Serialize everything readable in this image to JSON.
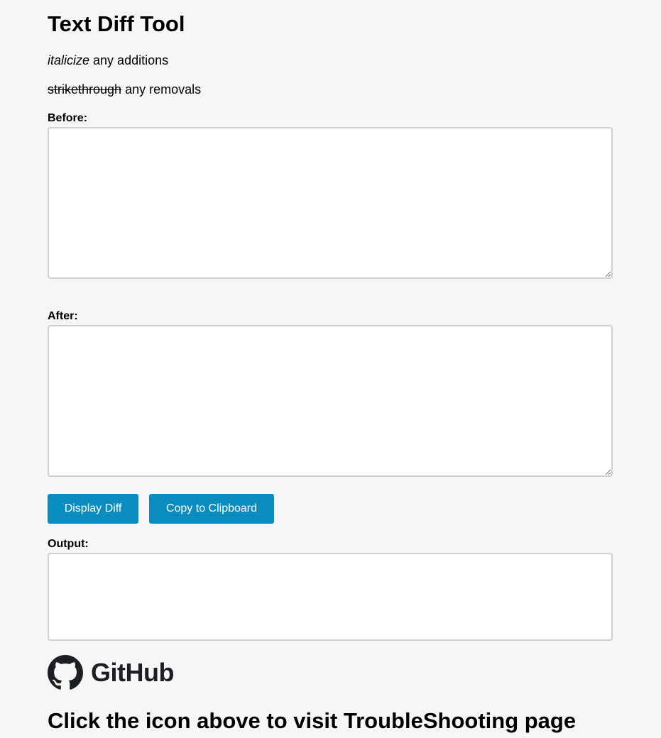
{
  "page": {
    "title": "Text Diff Tool",
    "legend_add_styled": "italicize",
    "legend_add_rest": " any additions",
    "legend_remove_styled": "strikethrough",
    "legend_remove_rest": " any removals"
  },
  "before": {
    "label": "Before:",
    "value": ""
  },
  "after": {
    "label": "After:",
    "value": ""
  },
  "buttons": {
    "display_diff": "Display Diff",
    "copy_clipboard": "Copy to Clipboard"
  },
  "output": {
    "label": "Output:",
    "value": ""
  },
  "footer": {
    "github_word": "GitHub",
    "cta": "Click the icon above to visit TroubleShooting page"
  },
  "colors": {
    "button_bg": "#0a8cbf",
    "button_text": "#ffffff",
    "page_bg": "#f6f6f6"
  },
  "icons": [
    "github-octocat-icon"
  ]
}
